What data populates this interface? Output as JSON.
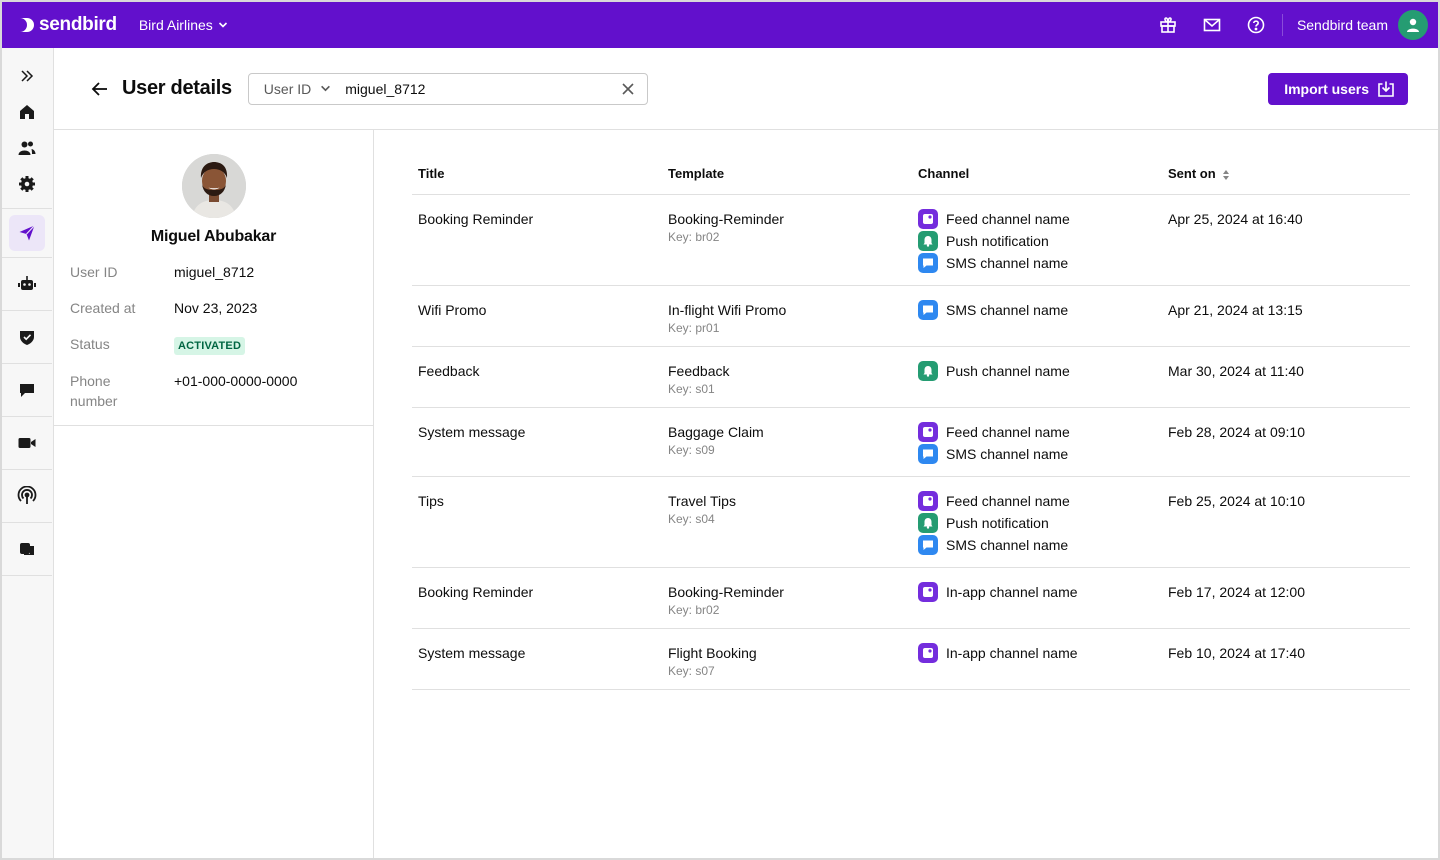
{
  "brand": {
    "name": "sendbird"
  },
  "org": {
    "name": "Bird Airlines"
  },
  "topbar": {
    "team_name": "Sendbird team"
  },
  "header": {
    "title": "User details",
    "search_type": "User ID",
    "search_value": "miguel_8712",
    "import_label": "Import users"
  },
  "profile": {
    "name": "Miguel Abubakar",
    "fields": [
      {
        "label": "User ID",
        "value": "miguel_8712"
      },
      {
        "label": "Created at",
        "value": "Nov 23, 2023"
      },
      {
        "label": "Status",
        "value": "ACTIVATED"
      },
      {
        "label": "Phone number",
        "value": "+01-000-0000-0000"
      }
    ]
  },
  "table": {
    "columns": [
      "Title",
      "Template",
      "Channel",
      "Sent on"
    ],
    "rows": [
      {
        "title": "Booking Reminder",
        "template": "Booking-Reminder",
        "key": "Key: br02",
        "channels": [
          {
            "type": "feed",
            "name": "Feed channel name"
          },
          {
            "type": "push",
            "name": "Push notification"
          },
          {
            "type": "sms",
            "name": "SMS channel name"
          }
        ],
        "sent_on": "Apr 25, 2024 at 16:40"
      },
      {
        "title": "Wifi Promo",
        "template": "In-flight Wifi Promo",
        "key": "Key: pr01",
        "channels": [
          {
            "type": "sms",
            "name": "SMS channel name"
          }
        ],
        "sent_on": "Apr 21, 2024 at 13:15"
      },
      {
        "title": "Feedback",
        "template": "Feedback",
        "key": "Key: s01",
        "channels": [
          {
            "type": "push",
            "name": "Push channel name"
          }
        ],
        "sent_on": "Mar 30, 2024 at 11:40"
      },
      {
        "title": "System message",
        "template": "Baggage Claim",
        "key": "Key: s09",
        "channels": [
          {
            "type": "feed",
            "name": "Feed channel name"
          },
          {
            "type": "sms",
            "name": "SMS channel name"
          }
        ],
        "sent_on": "Feb 28, 2024 at 09:10"
      },
      {
        "title": "Tips",
        "template": "Travel Tips",
        "key": "Key: s04",
        "channels": [
          {
            "type": "feed",
            "name": "Feed channel name"
          },
          {
            "type": "push",
            "name": "Push notification"
          },
          {
            "type": "sms",
            "name": "SMS channel name"
          }
        ],
        "sent_on": "Feb 25, 2024 at 10:10"
      },
      {
        "title": "Booking Reminder",
        "template": "Booking-Reminder",
        "key": "Key: br02",
        "channels": [
          {
            "type": "inapp",
            "name": "In-app channel name"
          }
        ],
        "sent_on": "Feb 17, 2024 at 12:00"
      },
      {
        "title": "System message",
        "template": "Flight Booking",
        "key": "Key: s07",
        "channels": [
          {
            "type": "inapp",
            "name": "In-app channel name"
          }
        ],
        "sent_on": "Feb 10, 2024 at 17:40"
      }
    ]
  },
  "colors": {
    "brand_purple": "#6210cc",
    "feed": "#742ddd",
    "push": "#259c72",
    "sms": "#2e88f0",
    "status_bg": "#d6f5e6",
    "status_text": "#006642"
  }
}
